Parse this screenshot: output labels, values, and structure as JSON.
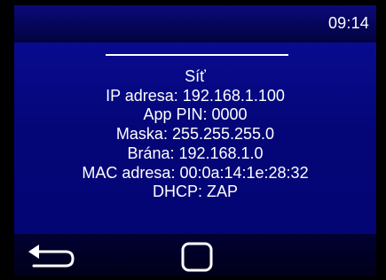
{
  "status_bar": {
    "time": "09:14"
  },
  "network_info": {
    "title": "Síť",
    "ip_address": "IP adresa: 192.168.1.100",
    "app_pin": "App PIN: 0000",
    "mask": "Maska: 255.255.255.0",
    "gateway": "Brána: 192.168.1.0",
    "mac_address": "MAC adresa: 00:0a:14:1e:28:32",
    "dhcp": "DHCP: ZAP"
  },
  "nav_bar": {
    "back_icon": "back-arrow-icon",
    "home_icon": "square-home-icon"
  },
  "colors": {
    "background": "#040678",
    "status_bar": "#02023f",
    "nav_bar": "#000019",
    "text": "#ffffff"
  }
}
